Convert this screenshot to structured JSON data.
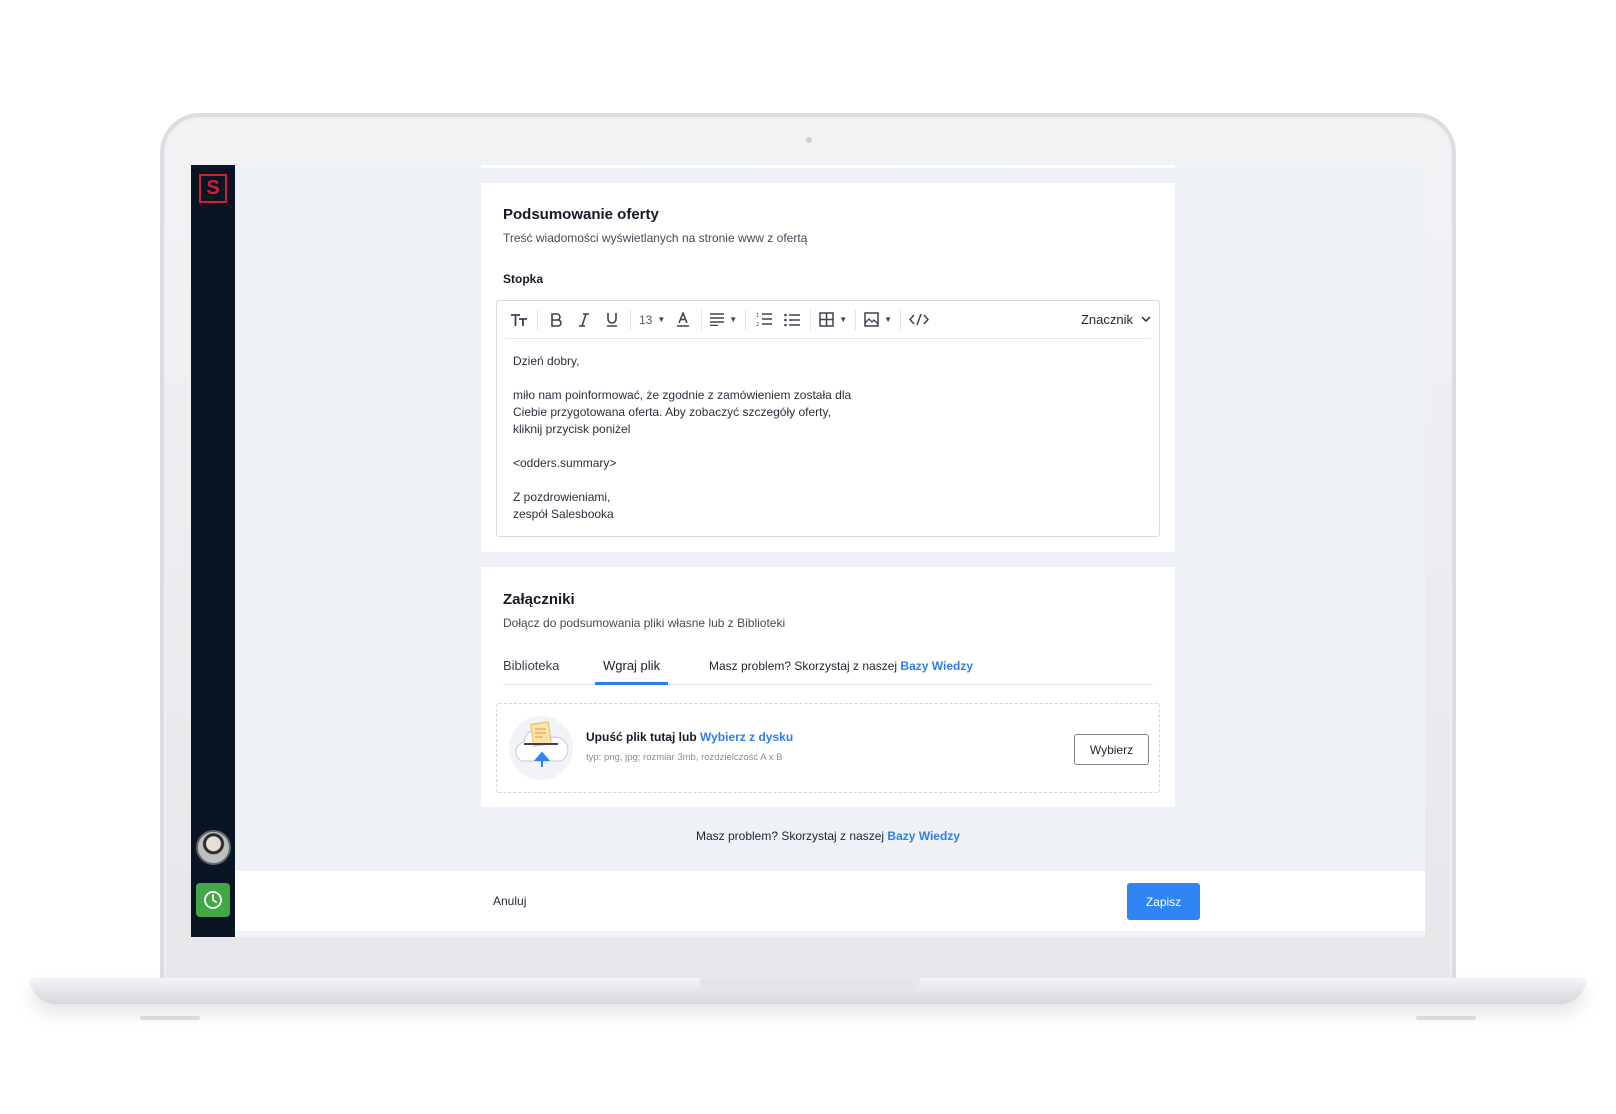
{
  "summary": {
    "title": "Podsumowanie oferty",
    "subtitle": "Treść wiadomości wyświetlanych na stronie www z ofertą",
    "field_label": "Stopka",
    "toolbar": {
      "font_size": "13",
      "marker_label": "Znacznik",
      "icons": [
        "text-size-icon",
        "bold-icon",
        "italic-icon",
        "underline-icon",
        "font-color-icon",
        "align-icon",
        "ordered-list-icon",
        "bullet-list-icon",
        "table-icon",
        "image-icon",
        "code-icon"
      ]
    },
    "body_lines": [
      "Dzień dobry,",
      "",
      "miło nam poinformować, że zgodnie z zamówieniem została dla",
      "Ciebie przygotowana oferta. Aby zobaczyć szczegóły oferty,",
      "kliknij przycisk poniżel",
      "",
      "<odders.summary>",
      "",
      "Z pozdrowieniami,",
      "zespół Salesbooka"
    ]
  },
  "attachments": {
    "title": "Załączniki",
    "subtitle": "Dołącz do podsumowania pliki własne lub z Biblioteki",
    "tabs": [
      {
        "label": "Biblioteka",
        "active": false
      },
      {
        "label": "Wgraj plik",
        "active": true
      }
    ],
    "tab_help_text": "Masz problem? Skorzystaj z naszej",
    "tab_help_link": "Bazy Wiedzy",
    "dropzone": {
      "title": "Upuść plik tutaj lub",
      "title_link": "Wybierz z dysku",
      "hint": "typ: png, jpg; rozmiar 3mb, rozdzielczość A x B",
      "button": "Wybierz"
    }
  },
  "page_help": {
    "text": "Masz problem? Skorzystaj z naszej",
    "link": "Bazy Wiedzy"
  },
  "footer": {
    "cancel": "Anuluj",
    "save": "Zapisz"
  },
  "sidebar": {
    "logo": "S",
    "icons": [
      "logo-icon",
      "avatar",
      "clock-icon"
    ]
  },
  "colors": {
    "accent": "#2f86f2",
    "link": "#2f7fe6",
    "sidebar": "#0b1423",
    "brand": "#d11f34",
    "timer": "#43a747",
    "page_bg": "#eef2f6"
  }
}
